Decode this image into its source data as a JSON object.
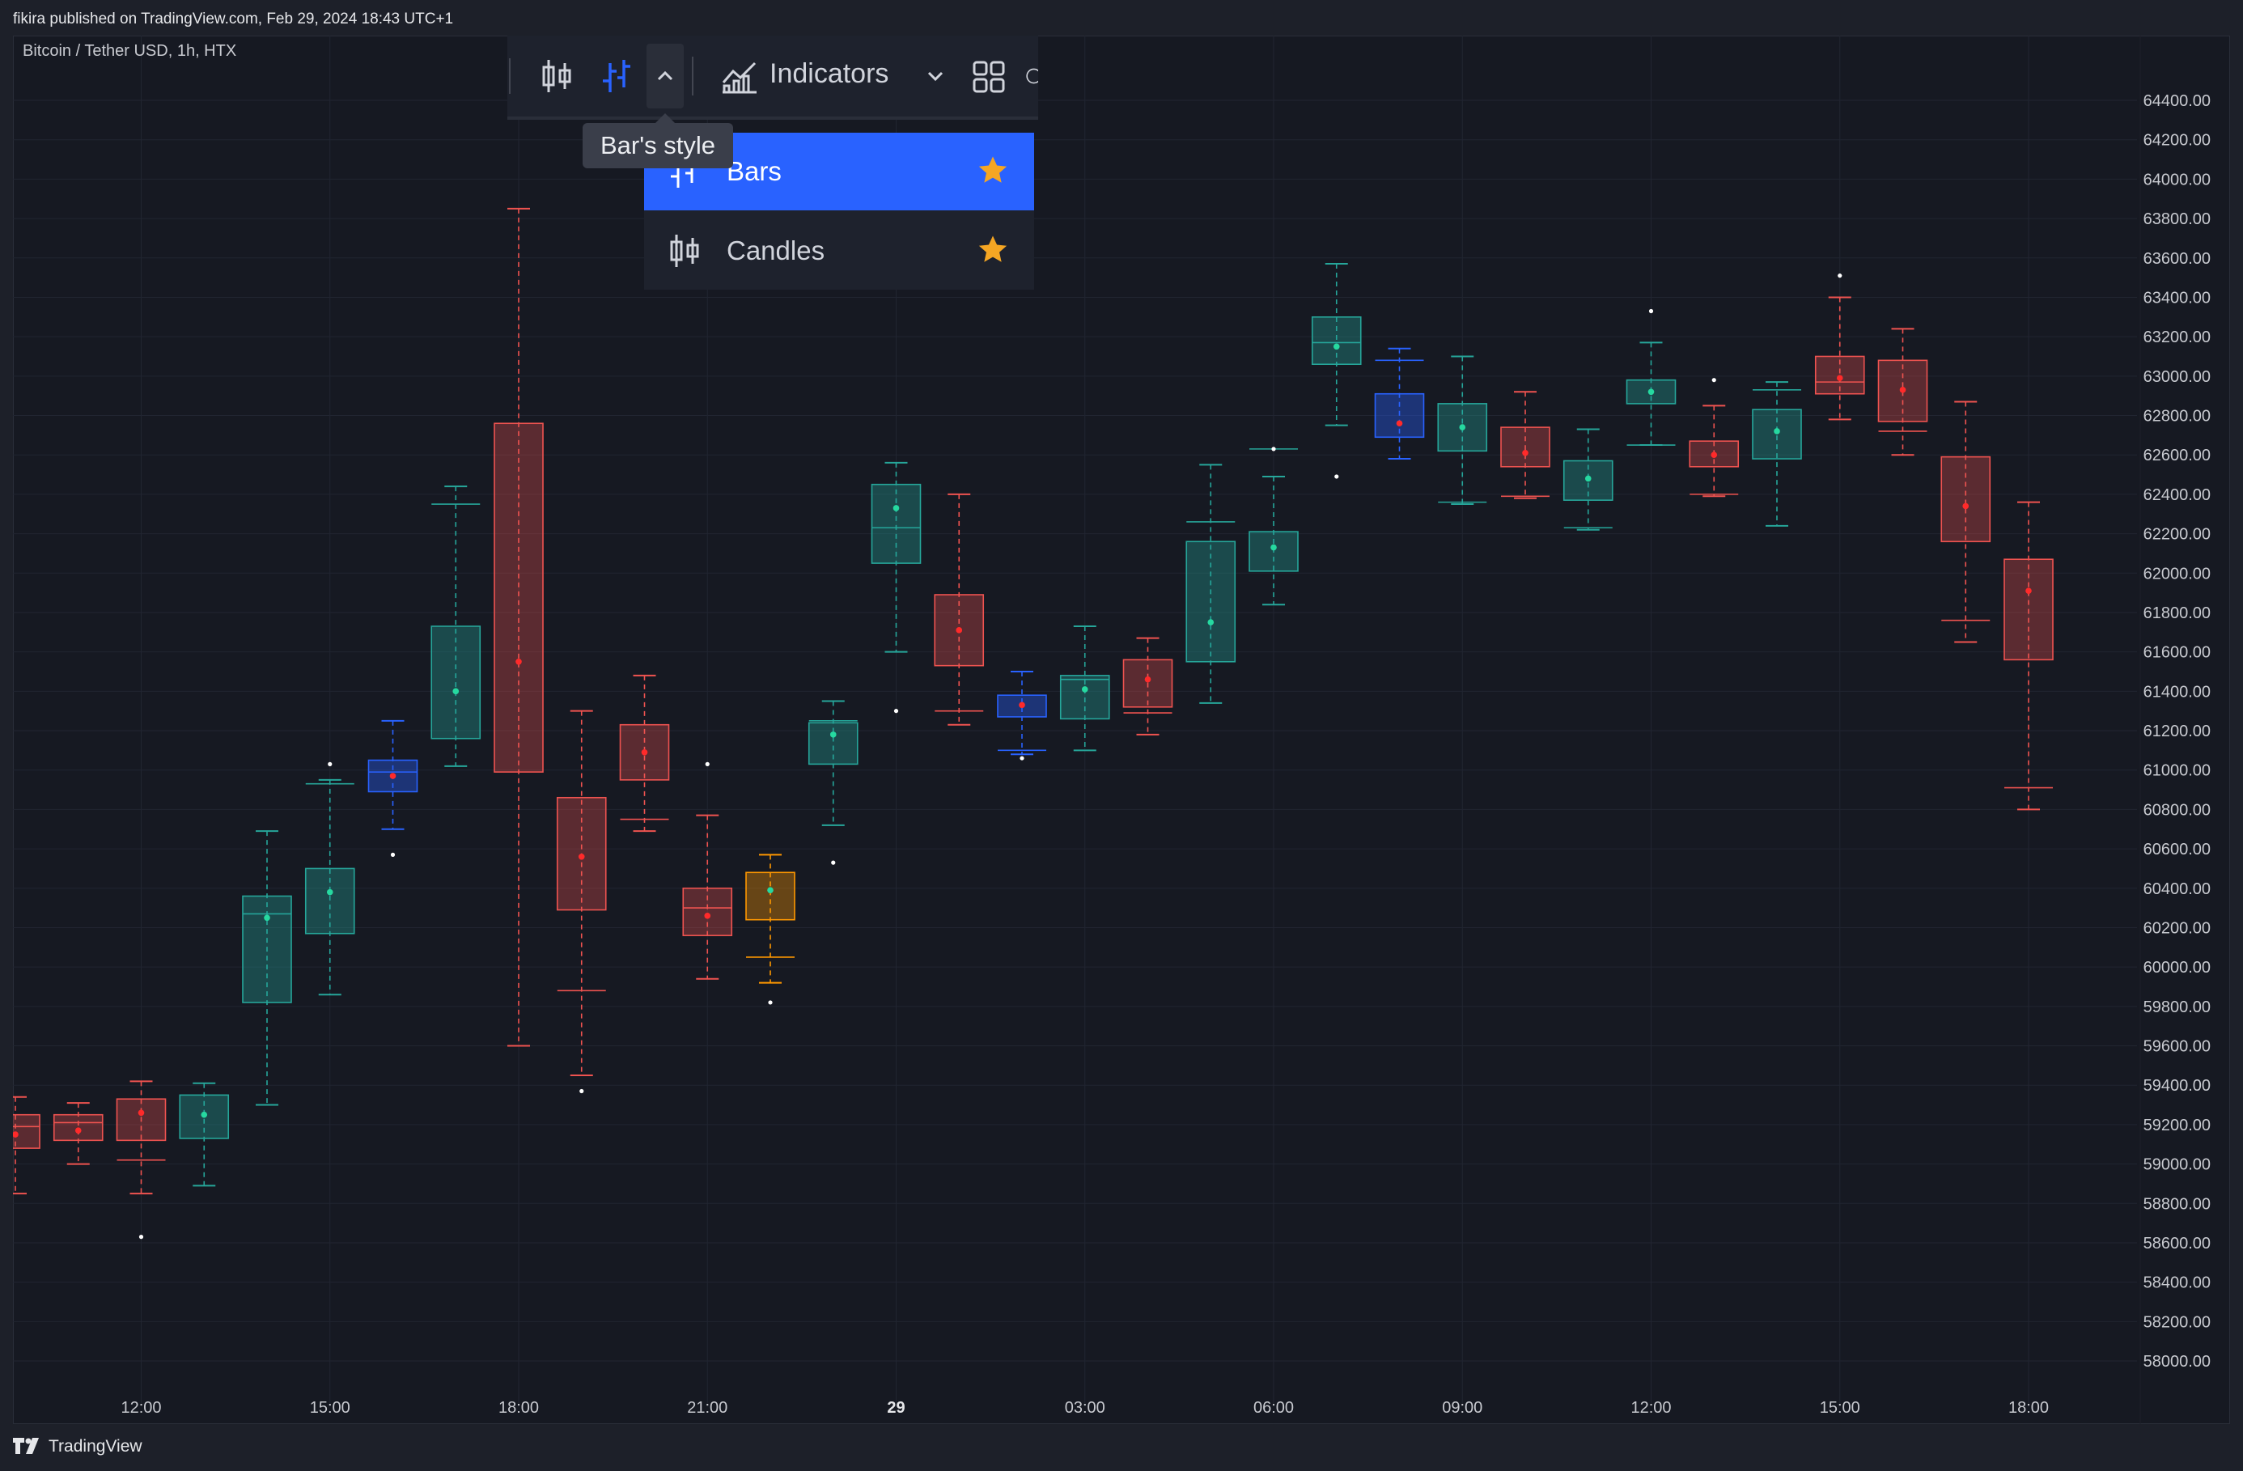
{
  "header": {
    "published_text": "fikira published on TradingView.com, Feb 29, 2024 18:43 UTC+1"
  },
  "symbol": {
    "label": "Bitcoin / Tether USD, 1h, HTX"
  },
  "toolbar": {
    "icons": [
      "candles-icon",
      "bars-icon",
      "chevron-up-icon",
      "indicators-icon",
      "chevron-down-icon",
      "layout-grid-icon"
    ],
    "indicators_label": "Indicators",
    "tooltip": "Bar's style"
  },
  "bar_style_menu": {
    "items": [
      {
        "label": "Bars",
        "selected": true,
        "favorite": true
      },
      {
        "label": "Candles",
        "selected": false,
        "favorite": true
      }
    ]
  },
  "footer": {
    "brand": "TradingView"
  },
  "colors": {
    "background": "#161922",
    "grid": "#222633",
    "bull": "#26a69a",
    "bear": "#ef5350",
    "blue": "#2962ff",
    "orange": "#ff9800",
    "star": "#f5a623",
    "text": "#c8cad0"
  },
  "chart_data": {
    "type": "candlestick",
    "y_range": [
      57800,
      64600
    ],
    "y_ticks": [
      58000,
      58200,
      58400,
      58600,
      58800,
      59000,
      59200,
      59400,
      59600,
      59800,
      60000,
      60200,
      60400,
      60600,
      60800,
      61000,
      61200,
      61400,
      61600,
      61800,
      62000,
      62200,
      62400,
      62600,
      62800,
      63000,
      63200,
      63400,
      63600,
      63800,
      64000,
      64200,
      64400
    ],
    "y_tick_labels": [
      "58000.00",
      "58200.00",
      "58400.00",
      "58600.00",
      "58800.00",
      "59000.00",
      "59200.00",
      "59400.00",
      "59600.00",
      "59800.00",
      "60000.00",
      "60200.00",
      "60400.00",
      "60600.00",
      "60800.00",
      "61000.00",
      "61200.00",
      "61400.00",
      "61600.00",
      "61800.00",
      "62000.00",
      "62200.00",
      "62400.00",
      "62600.00",
      "62800.00",
      "63000.00",
      "63200.00",
      "63400.00",
      "63600.00",
      "63800.00",
      "64000.00",
      "64200.00",
      "64400.00"
    ],
    "x_tick_labels": [
      {
        "index": 2,
        "label": "12:00",
        "bold": false
      },
      {
        "index": 5,
        "label": "15:00",
        "bold": false
      },
      {
        "index": 8,
        "label": "18:00",
        "bold": false
      },
      {
        "index": 11,
        "label": "21:00",
        "bold": false
      },
      {
        "index": 14,
        "label": "29",
        "bold": true
      },
      {
        "index": 17,
        "label": "03:00",
        "bold": false
      },
      {
        "index": 20,
        "label": "06:00",
        "bold": false
      },
      {
        "index": 23,
        "label": "09:00",
        "bold": false
      },
      {
        "index": 26,
        "label": "12:00",
        "bold": false
      },
      {
        "index": 29,
        "label": "15:00",
        "bold": false
      },
      {
        "index": 32,
        "label": "18:00",
        "bold": false
      }
    ],
    "candles": [
      {
        "box_top": 59250,
        "box_bottom": 59080,
        "upper_whisker": 59340,
        "lower_whisker": 58850,
        "mid": 59150,
        "inner": 59190,
        "extreme": null,
        "color": "bear"
      },
      {
        "box_top": 59250,
        "box_bottom": 59120,
        "upper_whisker": 59310,
        "lower_whisker": 59000,
        "mid": 59170,
        "inner": 59210,
        "extreme": null,
        "color": "bear"
      },
      {
        "box_top": 59330,
        "box_bottom": 59120,
        "upper_whisker": 59420,
        "lower_whisker": 58850,
        "mid": 59260,
        "inner": 59020,
        "extreme": 58630,
        "color": "bear"
      },
      {
        "box_top": 59350,
        "box_bottom": 59130,
        "upper_whisker": 59410,
        "lower_whisker": 58890,
        "mid": 59250,
        "inner": null,
        "extreme": null,
        "color": "bull"
      },
      {
        "box_top": 60360,
        "box_bottom": 59820,
        "upper_whisker": 60690,
        "lower_whisker": 59300,
        "mid": 60250,
        "inner": 60270,
        "extreme": null,
        "color": "bull"
      },
      {
        "box_top": 60500,
        "box_bottom": 60170,
        "upper_whisker": 60950,
        "lower_whisker": 59860,
        "mid": 60380,
        "inner": 60930,
        "extreme": 61030,
        "color": "bull"
      },
      {
        "box_top": 61050,
        "box_bottom": 60890,
        "upper_whisker": 61250,
        "lower_whisker": 60700,
        "mid": 60970,
        "inner": 60990,
        "extreme": 60570,
        "color": "blue"
      },
      {
        "box_top": 61730,
        "box_bottom": 61160,
        "upper_whisker": 62440,
        "lower_whisker": 61020,
        "mid": 61400,
        "inner": 62350,
        "extreme": null,
        "color": "bull"
      },
      {
        "box_top": 62760,
        "box_bottom": 60990,
        "upper_whisker": 63850,
        "lower_whisker": 59600,
        "mid": 61550,
        "inner": null,
        "extreme": null,
        "color": "bear"
      },
      {
        "box_top": 60860,
        "box_bottom": 60290,
        "upper_whisker": 61300,
        "lower_whisker": 59450,
        "mid": 60560,
        "inner": 59880,
        "extreme": 59370,
        "color": "bear"
      },
      {
        "box_top": 61230,
        "box_bottom": 60950,
        "upper_whisker": 61480,
        "lower_whisker": 60690,
        "mid": 61090,
        "inner": 60750,
        "extreme": null,
        "color": "bear"
      },
      {
        "box_top": 60400,
        "box_bottom": 60160,
        "upper_whisker": 60770,
        "lower_whisker": 59940,
        "mid": 60260,
        "inner": 60300,
        "extreme": 61030,
        "color": "bear"
      },
      {
        "box_top": 60480,
        "box_bottom": 60240,
        "upper_whisker": 60570,
        "lower_whisker": 59920,
        "mid": 60390,
        "inner": 60050,
        "extreme": 59820,
        "color": "orange"
      },
      {
        "box_top": 61240,
        "box_bottom": 61030,
        "upper_whisker": 61350,
        "lower_whisker": 60720,
        "mid": 61180,
        "inner": 61250,
        "extreme": 60530,
        "color": "bull"
      },
      {
        "box_top": 62450,
        "box_bottom": 62050,
        "upper_whisker": 62560,
        "lower_whisker": 61600,
        "mid": 62330,
        "inner": 62230,
        "extreme": 61300,
        "color": "bull"
      },
      {
        "box_top": 61890,
        "box_bottom": 61530,
        "upper_whisker": 62400,
        "lower_whisker": 61230,
        "mid": 61710,
        "inner": 61300,
        "extreme": null,
        "color": "bear"
      },
      {
        "box_top": 61380,
        "box_bottom": 61270,
        "upper_whisker": 61500,
        "lower_whisker": 61080,
        "mid": 61330,
        "inner": 61100,
        "extreme": 61060,
        "color": "blue"
      },
      {
        "box_top": 61480,
        "box_bottom": 61260,
        "upper_whisker": 61730,
        "lower_whisker": 61100,
        "mid": 61410,
        "inner": 61460,
        "extreme": null,
        "color": "bull"
      },
      {
        "box_top": 61560,
        "box_bottom": 61320,
        "upper_whisker": 61670,
        "lower_whisker": 61180,
        "mid": 61460,
        "inner": 61290,
        "extreme": null,
        "color": "bear"
      },
      {
        "box_top": 62160,
        "box_bottom": 61550,
        "upper_whisker": 62550,
        "lower_whisker": 61340,
        "mid": 61750,
        "inner": 62260,
        "extreme": null,
        "color": "bull"
      },
      {
        "box_top": 62210,
        "box_bottom": 62010,
        "upper_whisker": 62490,
        "lower_whisker": 61840,
        "mid": 62130,
        "inner": 62630,
        "extreme": 62630,
        "color": "bull"
      },
      {
        "box_top": 63300,
        "box_bottom": 63060,
        "upper_whisker": 63570,
        "lower_whisker": 62750,
        "mid": 63150,
        "inner": 63170,
        "extreme": 62490,
        "color": "bull"
      },
      {
        "box_top": 62910,
        "box_bottom": 62690,
        "upper_whisker": 63140,
        "lower_whisker": 62580,
        "mid": 62760,
        "inner": 63080,
        "extreme": null,
        "color": "blue"
      },
      {
        "box_top": 62860,
        "box_bottom": 62620,
        "upper_whisker": 63100,
        "lower_whisker": 62350,
        "mid": 62740,
        "inner": 62360,
        "extreme": null,
        "color": "bull"
      },
      {
        "box_top": 62740,
        "box_bottom": 62540,
        "upper_whisker": 62920,
        "lower_whisker": 62380,
        "mid": 62610,
        "inner": 62390,
        "extreme": null,
        "color": "bear"
      },
      {
        "box_top": 62570,
        "box_bottom": 62370,
        "upper_whisker": 62730,
        "lower_whisker": 62220,
        "mid": 62480,
        "inner": 62230,
        "extreme": null,
        "color": "bull"
      },
      {
        "box_top": 62980,
        "box_bottom": 62860,
        "upper_whisker": 63170,
        "lower_whisker": 62650,
        "mid": 62920,
        "inner": 62650,
        "extreme": 63330,
        "color": "bull"
      },
      {
        "box_top": 62670,
        "box_bottom": 62540,
        "upper_whisker": 62850,
        "lower_whisker": 62390,
        "mid": 62600,
        "inner": 62400,
        "extreme": 62980,
        "color": "bear"
      },
      {
        "box_top": 62830,
        "box_bottom": 62580,
        "upper_whisker": 62970,
        "lower_whisker": 62240,
        "mid": 62720,
        "inner": 62930,
        "extreme": null,
        "color": "bull"
      },
      {
        "box_top": 63100,
        "box_bottom": 62910,
        "upper_whisker": 63400,
        "lower_whisker": 62780,
        "mid": 62990,
        "inner": 62970,
        "extreme": 63510,
        "color": "bear"
      },
      {
        "box_top": 63080,
        "box_bottom": 62770,
        "upper_whisker": 63240,
        "lower_whisker": 62600,
        "mid": 62930,
        "inner": 62720,
        "extreme": null,
        "color": "bear"
      },
      {
        "box_top": 62590,
        "box_bottom": 62160,
        "upper_whisker": 62870,
        "lower_whisker": 61650,
        "mid": 62340,
        "inner": 61760,
        "extreme": null,
        "color": "bear"
      },
      {
        "box_top": 62070,
        "box_bottom": 61560,
        "upper_whisker": 62360,
        "lower_whisker": 60800,
        "mid": 61910,
        "inner": 60910,
        "extreme": null,
        "color": "bear"
      }
    ]
  }
}
